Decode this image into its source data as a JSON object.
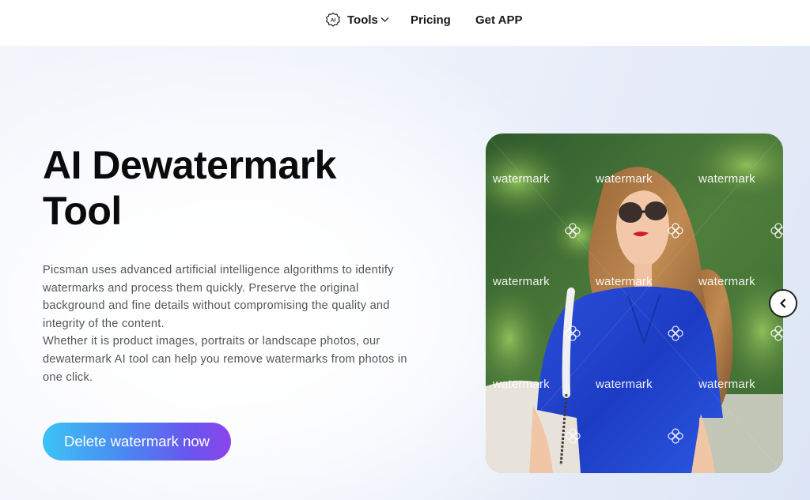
{
  "nav": {
    "tools_label": "Tools",
    "tools_icon": "ai-badge-icon",
    "pricing_label": "Pricing",
    "app_label": "Get APP"
  },
  "hero": {
    "title_line1": "AI Dewatermark",
    "title_line2": "Tool",
    "description_p1": "Picsman uses advanced artificial intelligence algorithms to identify watermarks and process them quickly. Preserve the original background and fine details without compromising the quality and integrity of the content.",
    "description_p2": "Whether it is product images, portraits or landscape photos, our dewatermark AI tool can help you remove watermarks from photos in one click.",
    "cta_label": "Delete watermark now"
  },
  "preview": {
    "watermark_text": "watermark",
    "watermark_icon": "clover-icon",
    "slider_icon": "chevron-left-icon"
  },
  "colors": {
    "cta_gradient": [
      "#3cc3f5",
      "#4b86f2",
      "#6a55ee",
      "#8a45ea"
    ],
    "text_primary": "#0b0b0b",
    "text_body": "#555555"
  }
}
